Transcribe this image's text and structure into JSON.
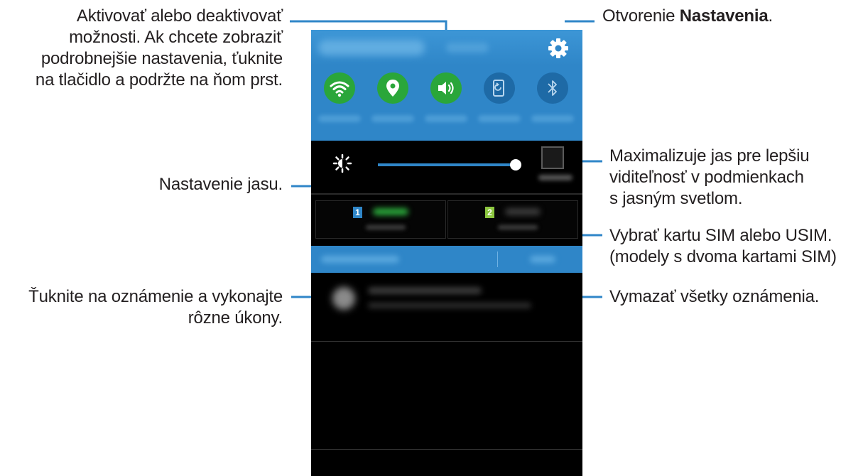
{
  "callouts": {
    "toggles": "Aktivovať alebo deaktivovať možnosti. Ak chcete zobraziť podrobnejšie nastavenia, ťuknite na tlačidlo a podržte na ňom prst.",
    "toggles_lines": [
      "Aktivovať alebo deaktivovať",
      "možnosti. Ak chcete zobraziť",
      "podrobnejšie nastavenia, ťuknite",
      "na tlačidlo a podržte na ňom prst."
    ],
    "settings_prefix": "Otvorenie ",
    "settings_bold": "Nastavenia",
    "settings_suffix": ".",
    "brightness": "Nastavenie jasu.",
    "outdoor_lines": [
      "Maximalizuje jas pre lepšiu",
      "viditeľnosť v podmienkach",
      "s jasným svetlom."
    ],
    "sim_lines": [
      "Vybrať kartu SIM alebo USIM.",
      "(modely s dvoma kartami SIM)"
    ],
    "clear": "Vymazať všetky oznámenia.",
    "notification_lines": [
      "Ťuknite na oznámenie a vykonajte",
      "rôzne úkony."
    ]
  },
  "panel": {
    "toggles": [
      {
        "name": "wifi-icon",
        "state": "on"
      },
      {
        "name": "location-icon",
        "state": "on"
      },
      {
        "name": "sound-icon",
        "state": "on"
      },
      {
        "name": "screen-rotation-icon",
        "state": "off"
      },
      {
        "name": "bluetooth-icon",
        "state": "off"
      }
    ],
    "sim_cards": [
      {
        "number": "1",
        "color": "#2f86c8",
        "accent": "#2aa63a"
      },
      {
        "number": "2",
        "color": "#8cc63f",
        "accent": "#3a3a3a"
      }
    ],
    "colors": {
      "panel_blue": "#2f86c8",
      "toggle_on": "#2aa63a",
      "toggle_off": "#1e6aa6",
      "background": "#000000"
    }
  }
}
